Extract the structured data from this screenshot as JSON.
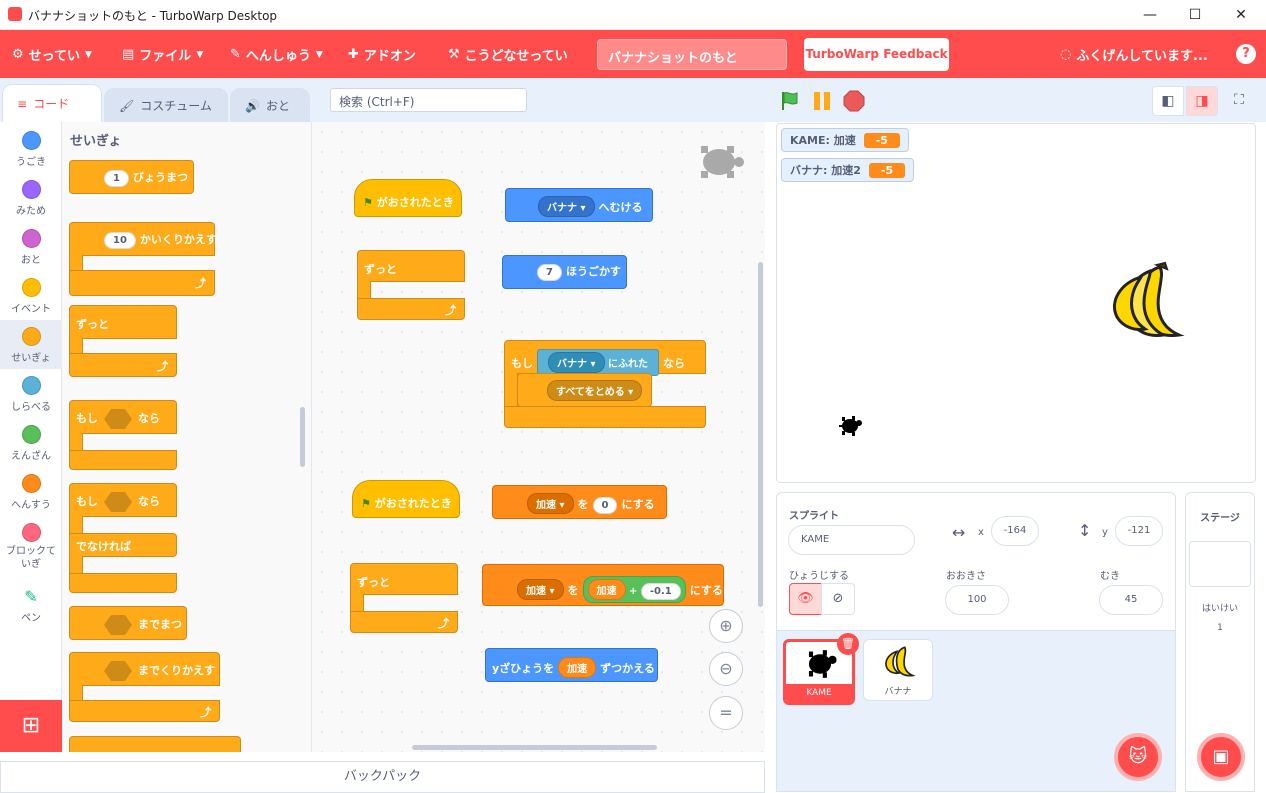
{
  "window": {
    "title": "バナナショットのもと - TurboWarp Desktop"
  },
  "menu": {
    "settings": "せってい",
    "file": "ファイル",
    "edit": "へんしゅう",
    "addons": "アドオン",
    "advanced": "こうどなせってい",
    "project_title": "バナナショットのもと",
    "feedback": "TurboWarp Feedback",
    "status": "ふくげんしています..."
  },
  "tabs": {
    "code": "コード",
    "costume": "コスチューム",
    "sound": "おと"
  },
  "search": {
    "placeholder": "検索 (Ctrl+F)"
  },
  "categories": [
    {
      "label": "うごき",
      "color": "#4c97ff"
    },
    {
      "label": "みため",
      "color": "#9966ff"
    },
    {
      "label": "おと",
      "color": "#cf63cf"
    },
    {
      "label": "イベント",
      "color": "#ffbf00"
    },
    {
      "label": "せいぎょ",
      "color": "#ffab19"
    },
    {
      "label": "しらべる",
      "color": "#5cb1d6"
    },
    {
      "label": "えんざん",
      "color": "#59c059"
    },
    {
      "label": "へんすう",
      "color": "#ff8c1a"
    },
    {
      "label": "ブロックていぎ",
      "color": "#ff6680"
    },
    {
      "label": "ペン",
      "color": "#0fbd8c"
    }
  ],
  "palette": {
    "heading": "せいぎょ",
    "wait_val": "1",
    "wait": "びょうまつ",
    "repeat_val": "10",
    "repeat": "かいくりかえす",
    "forever": "ずっと",
    "if": "もし",
    "then": "なら",
    "else": "でなければ",
    "wait_until": "までまつ",
    "repeat_until": "までくりかえす"
  },
  "script": {
    "flag_clicked": "がおされたとき",
    "forever": "ずっと",
    "point_sprite": "バナナ",
    "point_towards": "へむける",
    "move_val": "7",
    "move": "ほうごかす",
    "if": "もし",
    "touching_sprite": "バナナ",
    "touching": "にふれた",
    "then": "なら",
    "stop_all": "すべてをとめる",
    "var_name": "加速",
    "set_to": "を",
    "set_val": "0",
    "set_suffix": "にする",
    "plus": "+",
    "add_val": "-0.1",
    "change_y": "yざひょうを",
    "change_by": "ずつかえる"
  },
  "monitors": [
    {
      "label": "KAME: 加速",
      "value": "-5"
    },
    {
      "label": "バナナ: 加速2",
      "value": "-5"
    }
  ],
  "sprite_info": {
    "sprite_label": "スプライト",
    "sprite_name": "KAME",
    "x_label": "x",
    "x_val": "-164",
    "y_label": "y",
    "y_val": "-121",
    "show_label": "ひょうじする",
    "size_label": "おおきさ",
    "size_val": "100",
    "dir_label": "むき",
    "dir_val": "45"
  },
  "sprites": [
    {
      "name": "KAME",
      "selected": true
    },
    {
      "name": "バナナ",
      "selected": false
    }
  ],
  "stage_panel": {
    "title": "ステージ",
    "backdrops_label": "はいけい",
    "backdrops_count": "1"
  },
  "backpack": "バックパック"
}
